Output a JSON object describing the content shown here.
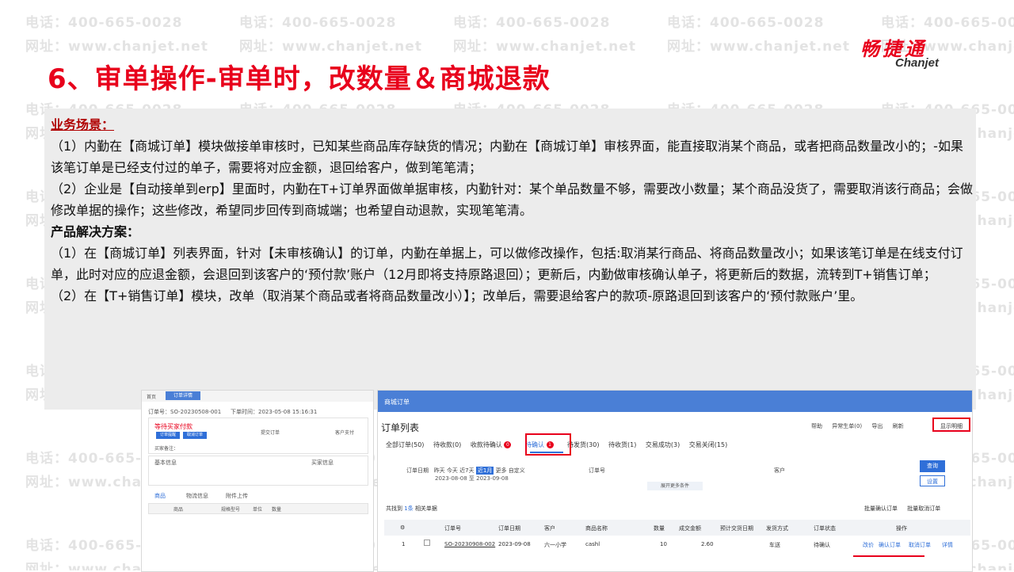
{
  "watermark": {
    "phone": "电话：400-665-0028",
    "site": "网址：www.chanjet.net"
  },
  "slide": {
    "title": "6、审单操作-审单时，改数量＆商城退款"
  },
  "logo": {
    "cn": "畅捷通",
    "en": "Chanjet"
  },
  "content": {
    "scenario_heading": "业务场景：",
    "scenario_1": "（1）内勤在【商城订单】模块做接单审核时，已知某些商品库存缺货的情况；内勤在【商城订单】审核界面，能直接取消某个商品，或者把商品数量改小的；-如果该笔订单是已经支付过的单子，需要将对应金额，退回给客户，做到笔笔清；",
    "scenario_2": "（2）企业是【自动接单到erp】里面时，内勤在T+订单界面做单据审核，内勤针对：某个单品数量不够，需要改小数量；某个商品没货了，需要取消该行商品；会做修改单据的操作；这些修改，希望同步回传到商城端；也希望自动退款，实现笔笔清。",
    "solution_heading": "产品解决方案：",
    "solution_1": "（1）在【商城订单】列表界面，针对【未审核确认】的订单，内勤在单据上，可以做修改操作，包括:取消某行商品、将商品数量改小；如果该笔订单是在线支付订单，此时对应的应退金额，会退回到该客户的‘预付款’账户（12月即将支持原路退回）；更新后，内勤做审核确认单子，将更新后的数据，流转到T+销售订单；",
    "solution_2": "（2）在【T+销售订单】模块，改单（取消某个商品或者将商品数量改小）】；改单后，需要退给客户的款项-原路退回到该客户的‘预付款账户’里。"
  },
  "screenshot_left": {
    "tab_home": "首页",
    "tab_active": "订单详情",
    "order_no": "订单号：SO-20230508-001",
    "order_time": "下单时间：2023-05-08 15:16:31",
    "status": "等待买家付款",
    "btn_1": "订单提醒",
    "btn_2": "取消订单",
    "step_1": "提交订单",
    "step_2": "客户支付",
    "buyer_label": "买家备注：",
    "section_basic": "基本信息",
    "section_buyer": "买家信息",
    "sub_tab_1": "商品",
    "sub_tab_2": "物流信息",
    "sub_tab_3": "附件上传",
    "col_1": "商品",
    "col_2": "规格型号",
    "col_3": "单位",
    "col_4": "数量"
  },
  "screenshot_right": {
    "top_bar": "商城订单",
    "title": "订单列表",
    "toolbar": [
      "帮助",
      "异常生单(0)",
      "导出",
      "刷新"
    ],
    "show_detail": "显示明细",
    "tabs": [
      {
        "label": "全部订单(50)"
      },
      {
        "label": "待收款(0)"
      },
      {
        "label": "收款待确认"
      },
      {
        "label": "待确认"
      },
      {
        "label": "待发货(30)"
      },
      {
        "label": "待收货(1)"
      },
      {
        "label": "交易成功(3)"
      },
      {
        "label": "交易关闭(15)"
      }
    ],
    "badge_payconfirm": "0",
    "badge_confirm": "1",
    "filter_label": "订单日期",
    "filter_options": [
      "昨天",
      "今天",
      "近7天",
      "近1月",
      "更多",
      "自定义"
    ],
    "filter_range": "2023-08-08 至 2023-09-08",
    "order_no_label": "订单号",
    "customer_label": "客户",
    "btn_query": "查询",
    "btn_reset": "设置",
    "expand_more": "展开更多条件",
    "found_prefix": "共找到",
    "found_count": "1条",
    "found_suffix": "相关单据",
    "batch_confirm": "批量确认订单",
    "batch_cancel": "批量取消订单",
    "columns": [
      "订单号",
      "订单日期",
      "客户",
      "商品名称",
      "数量",
      "成交金额",
      "预计交货日期",
      "发货方式",
      "订单状态",
      "操作"
    ],
    "rows": [
      {
        "index": "1",
        "order_no": "SO-20230908-002",
        "date": "2023-09-08",
        "customer": "六一小学",
        "product": "cashl",
        "qty": "10",
        "amount": "2.60",
        "delivery_date": "",
        "ship_method": "车送",
        "status": "待确认",
        "op_modify": "改价",
        "op_confirm": "确认订单",
        "op_cancel": "取消订单",
        "op_detail": "详情"
      }
    ]
  }
}
